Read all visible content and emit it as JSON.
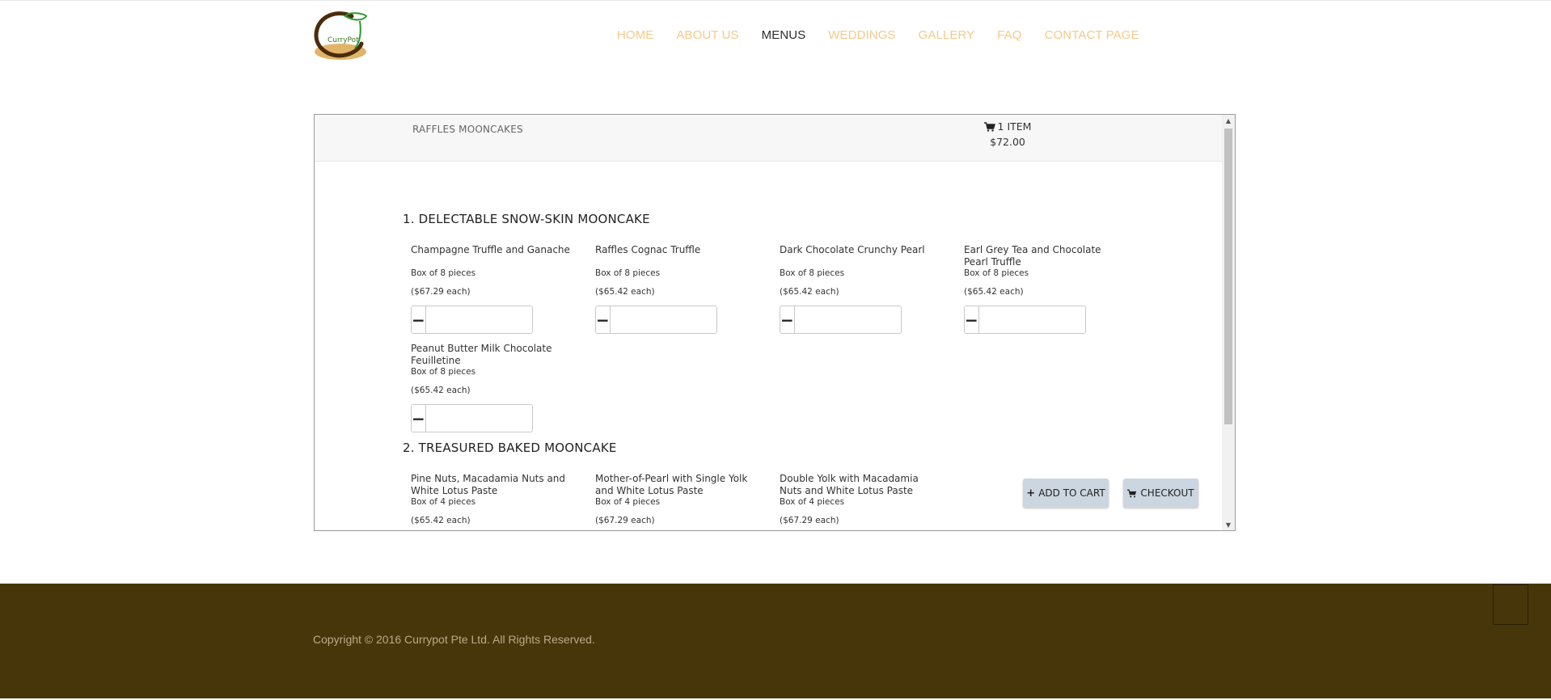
{
  "header": {
    "logo_text": "CurryPot",
    "nav": [
      {
        "label": "HOME"
      },
      {
        "label": "ABOUT US"
      },
      {
        "label": "MENUS"
      },
      {
        "label": "WEDDINGS"
      },
      {
        "label": "GALLERY"
      },
      {
        "label": "FAQ"
      },
      {
        "label": "CONTACT PAGE"
      }
    ],
    "active_nav": "MENUS"
  },
  "shop": {
    "store_name": "RAFFLES MOONCAKES",
    "cart": {
      "count_label": "1 ITEM",
      "total": "$72.00",
      "icon": "cart-icon"
    },
    "sections": [
      {
        "title": "1. DELECTABLE SNOW-SKIN MOONCAKE",
        "products": [
          {
            "name": "Champagne Truffle and Ganache",
            "box": "Box of 8 pieces",
            "price": "($67.29 each)"
          },
          {
            "name": "Raffles Cognac Truffle",
            "box": "Box of 8 pieces",
            "price": "($65.42 each)"
          },
          {
            "name": "Dark Chocolate Crunchy Pearl",
            "box": "Box of 8 pieces",
            "price": "($65.42 each)"
          },
          {
            "name": "Earl Grey Tea and Chocolate Pearl Truffle",
            "box": "Box of 8 pieces",
            "price": "($65.42 each)"
          },
          {
            "name": "Peanut Butter Milk Chocolate Feuilletine",
            "box": "Box of 8 pieces",
            "price": "($65.42 each)"
          }
        ]
      },
      {
        "title": "2. TREASURED BAKED MOONCAKE",
        "products": [
          {
            "name": "Pine Nuts, Macadamia Nuts and White Lotus Paste",
            "box": "Box of 4 pieces",
            "price": "($65.42 each)"
          },
          {
            "name": "Mother-of-Pearl with Single Yolk and White Lotus Paste",
            "box": "Box of 4 pieces",
            "price": "($67.29 each)"
          },
          {
            "name": "Double Yolk with Macadamia Nuts and White Lotus Paste",
            "box": "Box of 4 pieces",
            "price": "($67.29 each)"
          }
        ]
      }
    ],
    "qty_minus": "−",
    "qty_plus": "+",
    "buttons": {
      "add_to_cart": "ADD TO CART",
      "checkout": "CHECKOUT"
    }
  },
  "footer": {
    "copyright": "Copyright © 2016 Currypot Pte Ltd. All Rights Reserved."
  },
  "colors": {
    "nav": "#f5c98a",
    "nav_active": "#2c2c2c",
    "footer_bg": "#48360b",
    "button_bg": "#ccd6e0"
  }
}
